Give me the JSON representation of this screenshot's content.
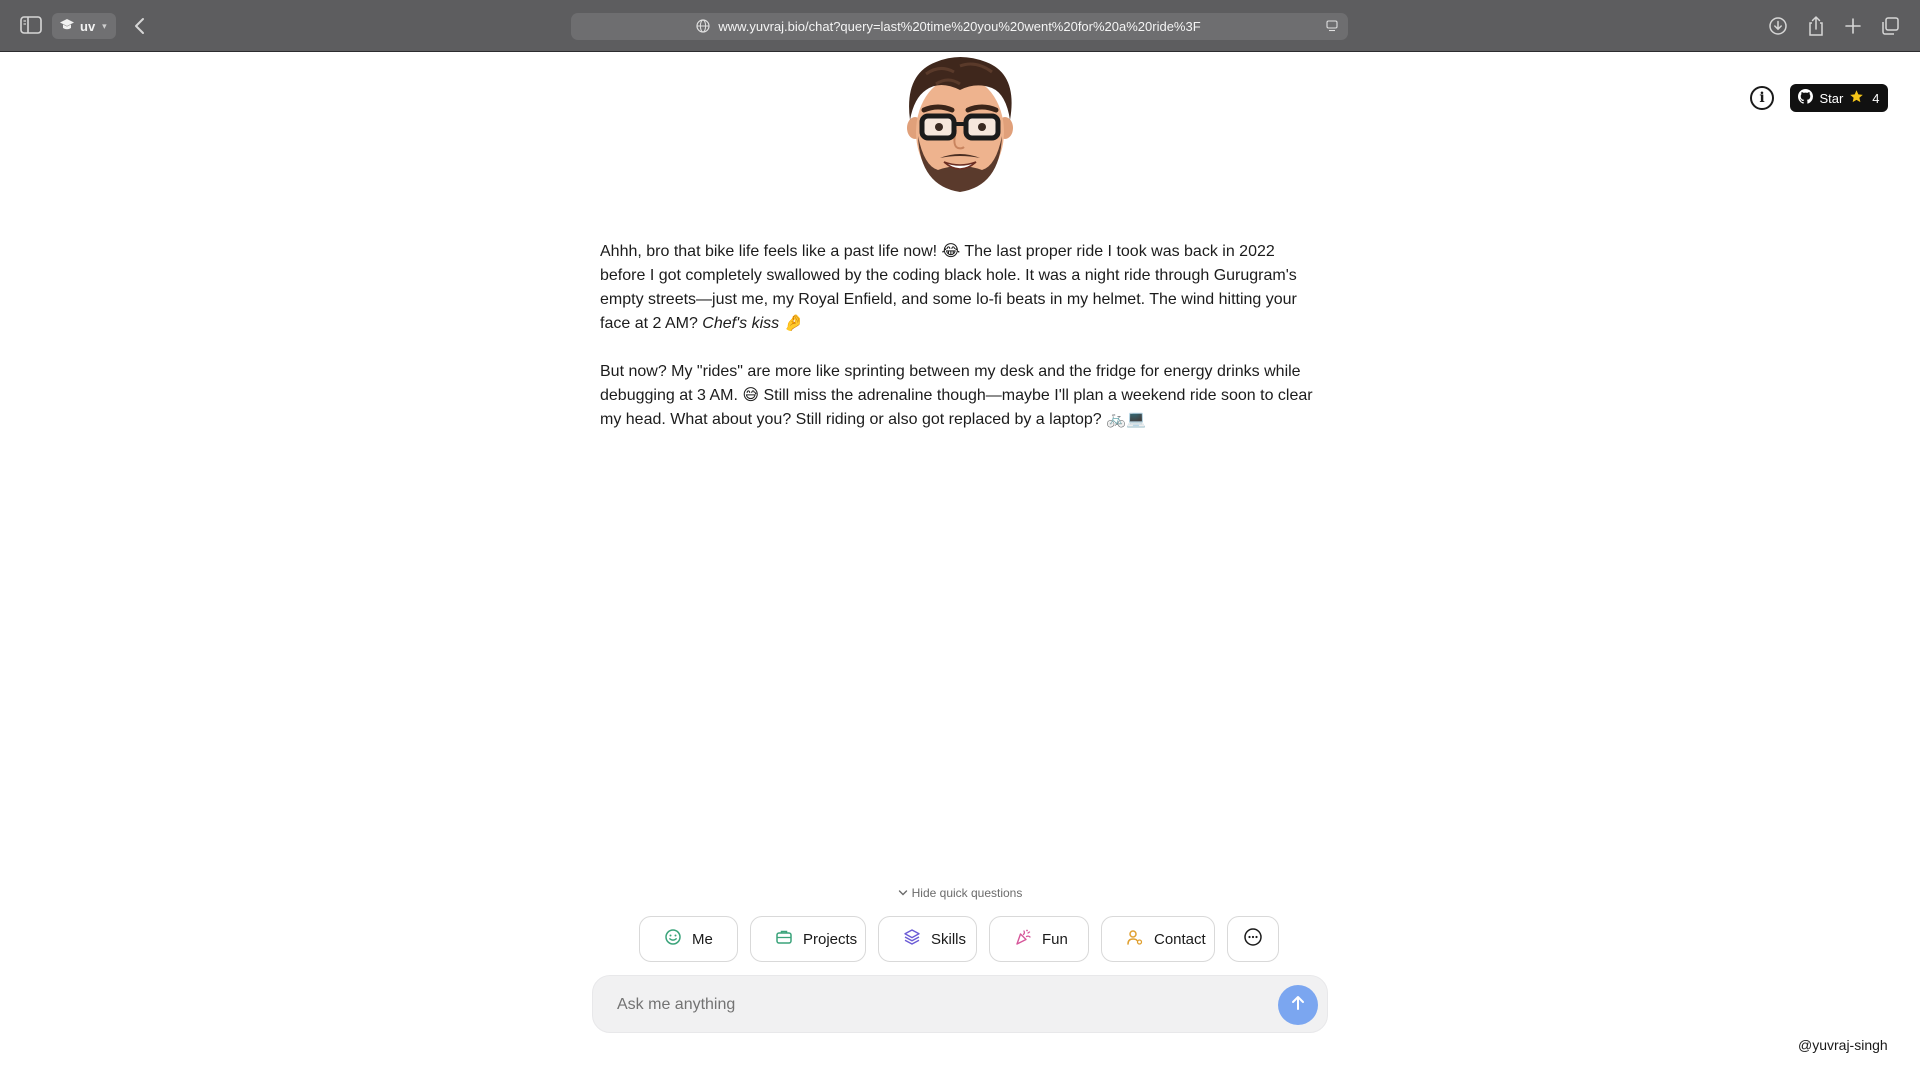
{
  "browser": {
    "tab_group_label": "uv",
    "url": "www.yuvraj.bio/chat?query=last%20time%20you%20went%20for%20a%20ride%3F",
    "icons": [
      "sidebar-icon",
      "graduation-cap-icon",
      "chevron-down-icon",
      "back-arrow-icon",
      "globe-icon",
      "reader-icon",
      "download-icon",
      "share-icon",
      "plus-icon",
      "tabs-overview-icon"
    ]
  },
  "header": {
    "info_icon": "info-icon",
    "github_star": {
      "label": "Star",
      "count": "4"
    }
  },
  "message": {
    "p1_a": "Ahhh, bro that bike life feels like a past life now! 😂 The last proper ride I took was back in 2022 before I got completely swallowed by the coding black hole. It was a night ride through Gurugram's empty streets—just me, my Royal Enfield, and some lo-fi beats in my helmet. The wind hitting your face at 2 AM? ",
    "p1_em": "Chef's kiss",
    "p1_b": " 🤌",
    "p2": "But now? My \"rides\" are more like sprinting between my desk and the fridge for energy drinks while debugging at 3 AM. 😅 Still miss the adrenaline though—maybe I'll plan a weekend ride soon to clear my head. What about you? Still riding or also got replaced by a laptop? 🚲💻"
  },
  "quick_questions": {
    "toggle_label": "Hide quick questions",
    "buttons": [
      {
        "label": "Me",
        "icon": "smile-icon",
        "color": "#3aa37a"
      },
      {
        "label": "Projects",
        "icon": "briefcase-icon",
        "color": "#3aa37a"
      },
      {
        "label": "Skills",
        "icon": "layers-icon",
        "color": "#6b5bd6"
      },
      {
        "label": "Fun",
        "icon": "party-popper-icon",
        "color": "#d6579a"
      },
      {
        "label": "Contact",
        "icon": "user-contact-icon",
        "color": "#e0a030"
      }
    ],
    "more_icon": "more-horizontal-icon"
  },
  "chat": {
    "placeholder": "Ask me anything",
    "send_color": "#7ba6f0"
  },
  "footer": {
    "handle": "@yuvraj-singh"
  }
}
